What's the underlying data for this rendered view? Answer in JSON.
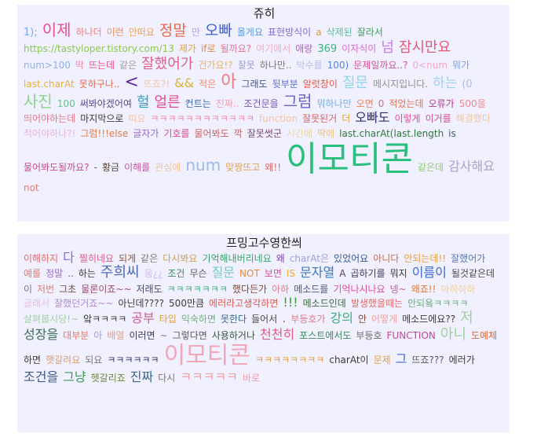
{
  "clouds": [
    {
      "title": "쥬히",
      "words": [
        {
          "t": "1);",
          "s": 13,
          "c": "#6fa8ff"
        },
        {
          "t": "이제",
          "s": 20,
          "c": "#e8508a"
        },
        {
          "t": "하나더",
          "s": 12,
          "c": "#f08080"
        },
        {
          "t": "이런",
          "s": 12,
          "c": "#f28c5a"
        },
        {
          "t": "안떠요",
          "s": 12,
          "c": "#f5a04a"
        },
        {
          "t": "정말",
          "s": 19,
          "c": "#e46b4b"
        },
        {
          "t": "만",
          "s": 12,
          "c": "#b6a3e6"
        },
        {
          "t": "오빠",
          "s": 19,
          "c": "#3d5fc7"
        },
        {
          "t": "올게요",
          "s": 12,
          "c": "#4f9be6"
        },
        {
          "t": "표현방식이",
          "s": 12,
          "c": "#7f6ad1"
        },
        {
          "t": "a",
          "s": 12,
          "c": "#e39a2d"
        },
        {
          "t": "삭제된",
          "s": 12,
          "c": "#58bfa0"
        },
        {
          "t": "잘라서",
          "s": 12,
          "c": "#3da05a"
        },
        {
          "t": "https://tastyloper.tistory.com/13",
          "s": 12,
          "c": "#8cc84b"
        },
        {
          "t": "제가",
          "s": 12,
          "c": "#e0a33a"
        },
        {
          "t": "if로",
          "s": 12,
          "c": "#e98b3a"
        },
        {
          "t": "될까요?",
          "s": 12,
          "c": "#e3738f"
        },
        {
          "t": "여기에서",
          "s": 12,
          "c": "#f6a9c3"
        },
        {
          "t": "애랑",
          "s": 12,
          "c": "#b35ec9"
        },
        {
          "t": "369",
          "s": 13,
          "c": "#3bb37e"
        },
        {
          "t": "이자식이",
          "s": 12,
          "c": "#d86bd0"
        },
        {
          "t": "넘",
          "s": 18,
          "c": "#c57be8"
        },
        {
          "t": "잠시만요",
          "s": 18,
          "c": "#e15a7a"
        },
        {
          "t": "num>100",
          "s": 12,
          "c": "#8ab4e8"
        },
        {
          "t": "딱",
          "s": 12,
          "c": "#f08fa8"
        },
        {
          "t": "뜨는데",
          "s": 12,
          "c": "#e8508a"
        },
        {
          "t": "같은",
          "s": 12,
          "c": "#a0a0a0"
        },
        {
          "t": "잘했어가",
          "s": 18,
          "c": "#e05f8a"
        },
        {
          "t": "건가요!?",
          "s": 12,
          "c": "#e6b45a"
        },
        {
          "t": "잘못",
          "s": 12,
          "c": "#9c9cd6"
        },
        {
          "t": "하나만..",
          "s": 12,
          "c": "#7a7a7a"
        },
        {
          "t": "박수를",
          "s": 12,
          "c": "#b6c0e8"
        },
        {
          "t": "100)",
          "s": 12,
          "c": "#4f86e6"
        },
        {
          "t": "문제일까요..?",
          "s": 12,
          "c": "#d6548a"
        },
        {
          "t": "0<num",
          "s": 12,
          "c": "#f0a8c8"
        },
        {
          "t": "뭐가",
          "s": 12,
          "c": "#7da1e0"
        },
        {
          "t": "last.charAt",
          "s": 12,
          "c": "#e8b23a"
        },
        {
          "t": "못하구나..",
          "s": 12,
          "c": "#e06b4b"
        },
        {
          "t": "<",
          "s": 22,
          "c": "#5a2ea8"
        },
        {
          "t": "뜨죠?!",
          "s": 12,
          "c": "#f5c49c"
        },
        {
          "t": "&&",
          "s": 16,
          "c": "#d8b23a"
        },
        {
          "t": "적은",
          "s": 12,
          "c": "#f09070"
        },
        {
          "t": "아",
          "s": 22,
          "c": "#f07a7a"
        },
        {
          "t": "그래도",
          "s": 12,
          "c": "#3a5b8e"
        },
        {
          "t": "뒷부분",
          "s": 12,
          "c": "#5a6fd0"
        },
        {
          "t": "알럿창이",
          "s": 12,
          "c": "#e05a4b"
        },
        {
          "t": "질문",
          "s": 18,
          "c": "#8fd4e6"
        },
        {
          "t": "메시지입니다.",
          "s": 12,
          "c": "#8f8f8f"
        },
        {
          "t": "하는",
          "s": 17,
          "c": "#9ad0f0"
        },
        {
          "t": "(0",
          "s": 13,
          "c": "#aebce6"
        },
        {
          "t": "사진",
          "s": 20,
          "c": "#8ad48a"
        },
        {
          "t": "100",
          "s": 12,
          "c": "#62c48a"
        },
        {
          "t": "써봐야겠어여",
          "s": 12,
          "c": "#5a4a8a"
        },
        {
          "t": "헐",
          "s": 18,
          "c": "#3a9ec0"
        },
        {
          "t": "얼른",
          "s": 18,
          "c": "#e0508a"
        },
        {
          "t": "컨트는",
          "s": 12,
          "c": "#3a6ab0"
        },
        {
          "t": "진짜..",
          "s": 12,
          "c": "#f0a0b0"
        },
        {
          "t": "조건문을",
          "s": 12,
          "c": "#7a5aa8"
        },
        {
          "t": "그럼",
          "s": 20,
          "c": "#6a62c8"
        },
        {
          "t": "뭐하나만",
          "s": 12,
          "c": "#7ab0e0"
        },
        {
          "t": "오면",
          "s": 12,
          "c": "#e6845a"
        },
        {
          "t": "0",
          "s": 12,
          "c": "#e06b7a"
        },
        {
          "t": "적었는데",
          "s": 12,
          "c": "#e6704b"
        },
        {
          "t": "오류가",
          "s": 12,
          "c": "#b03a8a"
        },
        {
          "t": "500을",
          "s": 12,
          "c": "#f08a8a"
        },
        {
          "t": "띄어야하는데",
          "s": 12,
          "c": "#e07a8a"
        },
        {
          "t": "마지막으로",
          "s": 12,
          "c": "#3a3a3a"
        },
        {
          "t": "띠요",
          "s": 12,
          "c": "#f6c4a8"
        },
        {
          "t": "ㅋㅋㅋㅋㅋㅋㅋㅋㅋㅋㅋㅋ",
          "s": 12,
          "c": "#f08aa8"
        },
        {
          "t": "function",
          "s": 12,
          "c": "#f6c49c"
        },
        {
          "t": "잘못된거",
          "s": 12,
          "c": "#e06060"
        },
        {
          "t": "더",
          "s": 12,
          "c": "#e8a23a"
        },
        {
          "t": "오빠도",
          "s": 16,
          "c": "#2e2e6a"
        },
        {
          "t": "이렇게",
          "s": 12,
          "c": "#e0508a"
        },
        {
          "t": "이거를",
          "s": 12,
          "c": "#d4508a"
        },
        {
          "t": "해결했다",
          "s": 12,
          "c": "#f0c8a0"
        },
        {
          "t": "적어야하나?!",
          "s": 12,
          "c": "#e6b4d8"
        },
        {
          "t": "그럼!!!else",
          "s": 12,
          "c": "#e07a4b"
        },
        {
          "t": "글자가",
          "s": 12,
          "c": "#9a6ad0"
        },
        {
          "t": "기호를",
          "s": 12,
          "c": "#d44a8a"
        },
        {
          "t": "물어봐도",
          "s": 12,
          "c": "#d4605a"
        },
        {
          "t": "깍",
          "s": 12,
          "c": "#c45a5a"
        },
        {
          "t": "잘못썻군",
          "s": 12,
          "c": "#7a4a6a"
        },
        {
          "t": "시간에",
          "s": 12,
          "c": "#e8d8a0"
        },
        {
          "t": "딱에",
          "s": 12,
          "c": "#e6c48a"
        },
        {
          "t": "last.charAt(last.length",
          "s": 12,
          "c": "#2e7a3a"
        },
        {
          "t": "is",
          "s": 12,
          "c": "#3a5a6a"
        },
        {
          "t": "물어봐도될까요?",
          "s": 12,
          "c": "#c0508a"
        },
        {
          "t": "-",
          "s": 12,
          "c": "#5a5a5a"
        },
        {
          "t": "황금",
          "s": 12,
          "c": "#5a4a3a"
        },
        {
          "t": "이해를",
          "s": 12,
          "c": "#c05aa0"
        },
        {
          "t": "관심에",
          "s": 12,
          "c": "#f0c4a0"
        },
        {
          "t": "num",
          "s": 20,
          "c": "#9abce6"
        },
        {
          "t": "맞짱뜨고",
          "s": 12,
          "c": "#e0a04b"
        },
        {
          "t": "왜!!",
          "s": 12,
          "c": "#d06a6a"
        },
        {
          "t": "이모티콘",
          "s": 44,
          "c": "#2bbf7e"
        },
        {
          "t": "같은데",
          "s": 12,
          "c": "#8fd06a"
        },
        {
          "t": "감사해요",
          "s": 16,
          "c": "#b0a0c8"
        },
        {
          "t": "not",
          "s": 12,
          "c": "#f07a6a"
        }
      ]
    },
    {
      "title": "프밍고수영한씌",
      "words": [
        {
          "t": "이해하지",
          "s": 12,
          "c": "#e06a6a"
        },
        {
          "t": "다",
          "s": 16,
          "c": "#8a6ad0"
        },
        {
          "t": "찔히네요",
          "s": 12,
          "c": "#e05a8a"
        },
        {
          "t": "되게",
          "s": 12,
          "c": "#8a5a3a"
        },
        {
          "t": "같은",
          "s": 12,
          "c": "#7a7a7a"
        },
        {
          "t": "다시봐요",
          "s": 12,
          "c": "#d0a04b"
        },
        {
          "t": "기억해내버리네요",
          "s": 12,
          "c": "#3aa06a"
        },
        {
          "t": "왜",
          "s": 12,
          "c": "#7a4aa0"
        },
        {
          "t": "charAt은",
          "s": 12,
          "c": "#a0a0d8"
        },
        {
          "t": "있었어요",
          "s": 12,
          "c": "#3a5a8a"
        },
        {
          "t": "아니다",
          "s": 12,
          "c": "#d06a4b"
        },
        {
          "t": "안되는데!!",
          "s": 12,
          "c": "#e8a03a"
        },
        {
          "t": "잘했어가",
          "s": 12,
          "c": "#5a7ab0"
        },
        {
          "t": "예를",
          "s": 12,
          "c": "#e07a6a"
        },
        {
          "t": "정말",
          "s": 12,
          "c": "#9a6ad0"
        },
        {
          "t": "..",
          "s": 12,
          "c": "#7a4a8a"
        },
        {
          "t": "하는",
          "s": 12,
          "c": "#3a3a3a"
        },
        {
          "t": "주희씨",
          "s": 18,
          "c": "#4a6ab0"
        },
        {
          "t": "음¿¿",
          "s": 12,
          "c": "#d0b8f0"
        },
        {
          "t": "조건",
          "s": 12,
          "c": "#3a8a5a"
        },
        {
          "t": "무슨",
          "s": 12,
          "c": "#5a5a5a"
        },
        {
          "t": "질문",
          "s": 16,
          "c": "#6ad0c0"
        },
        {
          "t": "NOT",
          "s": 12,
          "c": "#e08a3a"
        },
        {
          "t": "보면",
          "s": 12,
          "c": "#e0508a"
        },
        {
          "t": "IS",
          "s": 12,
          "c": "#e8b03a"
        },
        {
          "t": "문자열",
          "s": 16,
          "c": "#3a7ac0"
        },
        {
          "t": "A",
          "s": 12,
          "c": "#5a3a6a"
        },
        {
          "t": "곱하기를",
          "s": 12,
          "c": "#3a3a5a"
        },
        {
          "t": "뭐지",
          "s": 12,
          "c": "#3a3a3a"
        },
        {
          "t": "이름이",
          "s": 16,
          "c": "#3a6ad0"
        },
        {
          "t": "될것같은데",
          "s": 12,
          "c": "#4a4a4a"
        },
        {
          "t": "이",
          "s": 12,
          "c": "#7a7a7a"
        },
        {
          "t": "저번",
          "s": 12,
          "c": "#e07a6a"
        },
        {
          "t": "그초",
          "s": 12,
          "c": "#6a4a3a"
        },
        {
          "t": "물론이죠~~",
          "s": 12,
          "c": "#a04a6a"
        },
        {
          "t": "저래도",
          "s": 12,
          "c": "#4a4a6a"
        },
        {
          "t": "ㅋㅋㅋㅋㅋㅋㅋ",
          "s": 12,
          "c": "#3ab07a"
        },
        {
          "t": "했다든가",
          "s": 12,
          "c": "#7a4a3a"
        },
        {
          "t": "아하",
          "s": 12,
          "c": "#e07a8a"
        },
        {
          "t": "메소드를",
          "s": 12,
          "c": "#4a5a7a"
        },
        {
          "t": "기억나시나요",
          "s": 12,
          "c": "#e0508a"
        },
        {
          "t": "넹~",
          "s": 12,
          "c": "#c05a9a"
        },
        {
          "t": "왜죠!!",
          "s": 12,
          "c": "#e07a3a"
        },
        {
          "t": "아하하하",
          "s": 12,
          "c": "#f0d090"
        },
        {
          "t": "글래서",
          "s": 12,
          "c": "#e0c0e0"
        },
        {
          "t": "잘했던거죠~~",
          "s": 12,
          "c": "#b08ad0"
        },
        {
          "t": "아닌데????",
          "s": 12,
          "c": "#3a3a3a"
        },
        {
          "t": "500만큼",
          "s": 12,
          "c": "#3a3a3a"
        },
        {
          "t": "에러라고생각하면",
          "s": 12,
          "c": "#e05a4b"
        },
        {
          "t": "!!!",
          "s": 16,
          "c": "#3aa03a"
        },
        {
          "t": "메소드인데",
          "s": 12,
          "c": "#3a6a3a"
        },
        {
          "t": "발생했을때는",
          "s": 12,
          "c": "#e06a6a"
        },
        {
          "t": "안되욬ㅋㅋㅋㅋ",
          "s": 12,
          "c": "#6ab07a"
        },
        {
          "t": "살펴봅시당!~",
          "s": 12,
          "c": "#a0d0a0"
        },
        {
          "t": "앜ㅋㅋㅋㅋ",
          "s": 12,
          "c": "#3a3a3a"
        },
        {
          "t": "공부",
          "s": 16,
          "c": "#d05a8a"
        },
        {
          "t": "타입",
          "s": 12,
          "c": "#e0a03a"
        },
        {
          "t": "익숙하면",
          "s": 12,
          "c": "#6ab07a"
        },
        {
          "t": "못한다",
          "s": 12,
          "c": "#3a6a8a"
        },
        {
          "t": "들어서",
          "s": 12,
          "c": "#4a4a4a"
        },
        {
          "t": ".",
          "s": 16,
          "c": "#e05a4b"
        },
        {
          "t": "부등호가",
          "s": 12,
          "c": "#e07a8a"
        },
        {
          "t": "강의",
          "s": 16,
          "c": "#3ab07a"
        },
        {
          "t": "안",
          "s": 12,
          "c": "#7a4a3a"
        },
        {
          "t": "어떻게",
          "s": 12,
          "c": "#f0a0a0"
        },
        {
          "t": "메소드에요??",
          "s": 12,
          "c": "#3a3a3a"
        },
        {
          "t": "저",
          "s": 18,
          "c": "#a0d0a0"
        },
        {
          "t": "성장을",
          "s": 16,
          "c": "#3a6a5a"
        },
        {
          "t": "대부분",
          "s": 12,
          "c": "#e07a6a"
        },
        {
          "t": "아",
          "s": 12,
          "c": "#a0a0d8"
        },
        {
          "t": "배열",
          "s": 12,
          "c": "#e0a08a"
        },
        {
          "t": "이러면",
          "s": 12,
          "c": "#3a3a5a"
        },
        {
          "t": "~",
          "s": 12,
          "c": "#7a7a7a"
        },
        {
          "t": "그렇다면",
          "s": 12,
          "c": "#5a5a5a"
        },
        {
          "t": "사용하거나",
          "s": 12,
          "c": "#3a5a3a"
        },
        {
          "t": "천천히",
          "s": 16,
          "c": "#e05a8a"
        },
        {
          "t": "포스트에서도",
          "s": 12,
          "c": "#3a8a5a"
        },
        {
          "t": "부등호",
          "s": 12,
          "c": "#6a6a6a"
        },
        {
          "t": "FUNCTION",
          "s": 12,
          "c": "#c04a9a"
        },
        {
          "t": "아니",
          "s": 18,
          "c": "#a0d0a0"
        },
        {
          "t": "도예체",
          "s": 12,
          "c": "#e06a3a"
        },
        {
          "t": "하면",
          "s": 12,
          "c": "#3a3a3a"
        },
        {
          "t": "햇갈려요",
          "s": 12,
          "c": "#e0a06a"
        },
        {
          "t": "되요",
          "s": 12,
          "c": "#7a7a7a"
        },
        {
          "t": "ㅋㅋㅋㅋㅋㅋ",
          "s": 12,
          "c": "#3a3a6a"
        },
        {
          "t": "이모티콘",
          "s": 30,
          "c": "#f0a8b8"
        },
        {
          "t": "ㅋㅋㅋㅋㅋㅋㅋㅋ",
          "s": 12,
          "c": "#e0a03a"
        },
        {
          "t": "charAt이",
          "s": 12,
          "c": "#3a3a3a"
        },
        {
          "t": "문제",
          "s": 12,
          "c": "#e0a03a"
        },
        {
          "t": "그",
          "s": 16,
          "c": "#3a6ad0"
        },
        {
          "t": "뜨죠???",
          "s": 12,
          "c": "#5a5a5a"
        },
        {
          "t": "에러가",
          "s": 12,
          "c": "#3a3a3a"
        },
        {
          "t": "조건을",
          "s": 16,
          "c": "#3a5a8a"
        },
        {
          "t": "그냥",
          "s": 16,
          "c": "#3a9a5a"
        },
        {
          "t": "헷갈리죠",
          "s": 12,
          "c": "#6a8a3a"
        },
        {
          "t": "진짜",
          "s": 16,
          "c": "#3a6a8a"
        },
        {
          "t": "다시",
          "s": 12,
          "c": "#7a7a7a"
        },
        {
          "t": "ㅋㅋㅋㅋㅋ",
          "s": 16,
          "c": "#f0a0a8"
        },
        {
          "t": "바로",
          "s": 12,
          "c": "#f0a0a8"
        }
      ]
    }
  ]
}
